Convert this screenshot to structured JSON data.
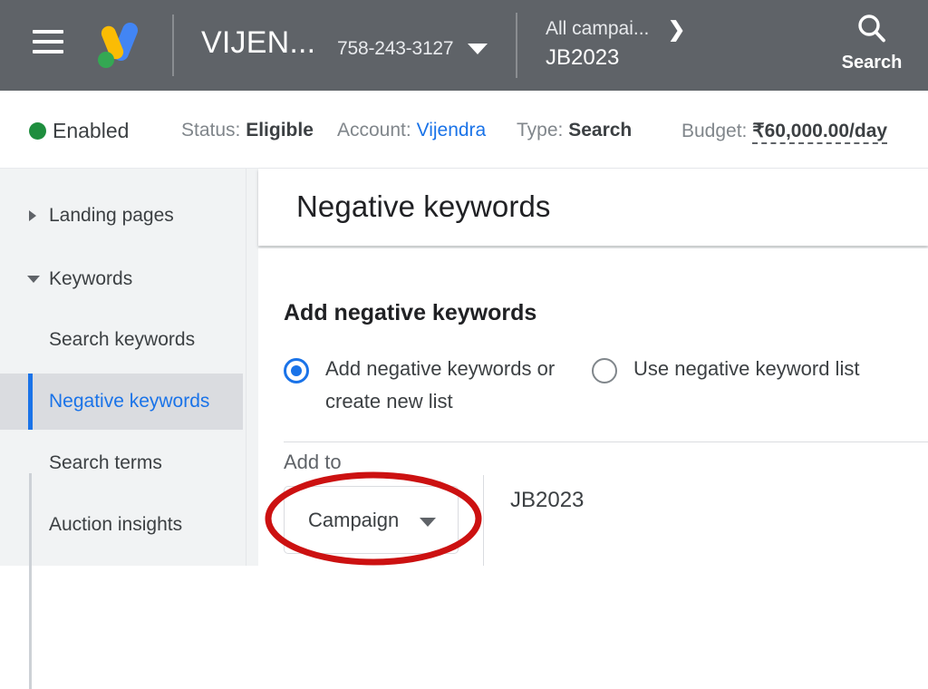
{
  "topbar": {
    "menu_icon": "hamburger-menu-icon",
    "logo_icon": "google-ads-logo",
    "account_name": "VIJEN...",
    "account_id": "758-243-3127",
    "account_caret_icon": "chevron-down-icon",
    "breadcrumb": {
      "parent": "All campai...",
      "separator_icon": "chevron-right-icon",
      "current": "JB2023"
    },
    "search": {
      "icon": "search-icon",
      "label": "Search"
    },
    "bg_color": "#5f6368"
  },
  "status_bar": {
    "state_dot_color": "#1e8e3e",
    "state": "Enabled",
    "fields": [
      {
        "label": "Status:",
        "value": "Eligible"
      },
      {
        "label": "Account:",
        "value": "Vijendra"
      },
      {
        "label": "Type:",
        "value": "Search"
      },
      {
        "label": "Budget:",
        "value": "₹60,000.00/day"
      }
    ]
  },
  "sidebar": {
    "groups": [
      {
        "label": "Landing pages",
        "expanded": false,
        "icon": "triangle-right-icon"
      },
      {
        "label": "Keywords",
        "expanded": true,
        "icon": "triangle-down-icon"
      }
    ],
    "items": [
      {
        "label": "Search keywords",
        "selected": false
      },
      {
        "label": "Negative keywords",
        "selected": true
      },
      {
        "label": "Search terms",
        "selected": false
      },
      {
        "label": "Auction insights",
        "selected": false
      }
    ],
    "selected_color": "#1a73e8"
  },
  "main": {
    "page_title": "Negative keywords",
    "section_title": "Add negative keywords",
    "radio_options": [
      {
        "label": "Add negative keywords or create new list",
        "selected": true
      },
      {
        "label": "Use negative keyword list",
        "selected": false
      }
    ],
    "add_to_label": "Add to",
    "dropdown": {
      "value": "Campaign",
      "caret_icon": "chevron-down-icon"
    },
    "target_value": "JB2023"
  },
  "annotation": {
    "shape": "ellipse",
    "color": "#cc1111",
    "target": "campaign-dropdown"
  }
}
